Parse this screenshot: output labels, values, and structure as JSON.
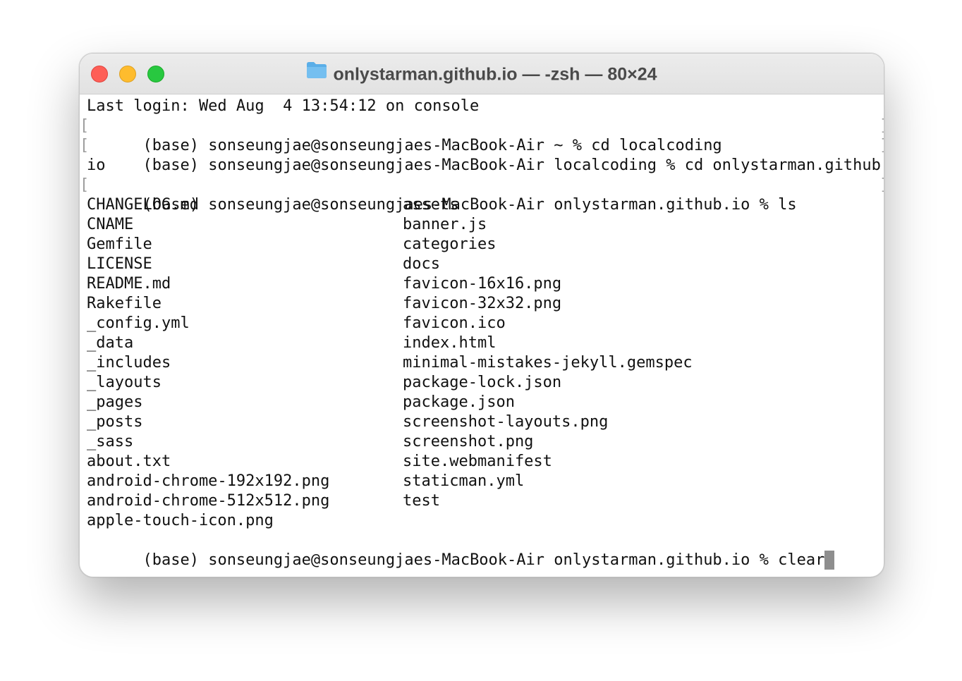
{
  "window": {
    "title": "onlystarman.github.io — -zsh — 80×24",
    "folder_icon": "folder-icon",
    "traffic_lights": {
      "close": "#fe5f57",
      "minimize": "#febc2e",
      "zoom": "#28c840"
    }
  },
  "terminal": {
    "last_login": "Last login: Wed Aug  4 13:54:12 on console",
    "commands": [
      "(base) sonseungjae@sonseungjaes-MacBook-Air ~ % cd localcoding",
      "(base) sonseungjae@sonseungjaes-MacBook-Air localcoding % cd onlystarman.github.",
      "io",
      "(base) sonseungjae@sonseungjaes-MacBook-Air onlystarman.github.io % ls"
    ],
    "mark_left": "[",
    "mark_right": "]",
    "listing_col1": [
      "CHANGELOG.md",
      "CNAME",
      "Gemfile",
      "LICENSE",
      "README.md",
      "Rakefile",
      "_config.yml",
      "_data",
      "_includes",
      "_layouts",
      "_pages",
      "_posts",
      "_sass",
      "about.txt",
      "android-chrome-192x192.png",
      "android-chrome-512x512.png",
      "apple-touch-icon.png"
    ],
    "listing_col2": [
      "assets",
      "banner.js",
      "categories",
      "docs",
      "favicon-16x16.png",
      "favicon-32x32.png",
      "favicon.ico",
      "index.html",
      "minimal-mistakes-jekyll.gemspec",
      "package-lock.json",
      "package.json",
      "screenshot-layouts.png",
      "screenshot.png",
      "site.webmanifest",
      "staticman.yml",
      "test",
      ""
    ],
    "current_prompt": "(base) sonseungjae@sonseungjaes-MacBook-Air onlystarman.github.io % clear",
    "cursor_color": "#8e8e8e"
  }
}
